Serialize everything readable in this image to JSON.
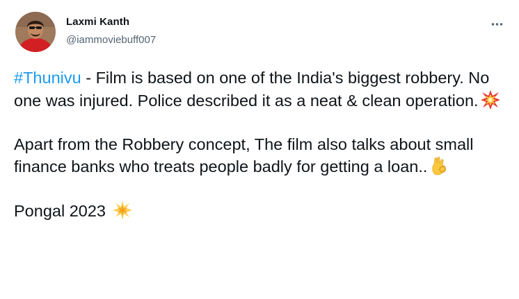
{
  "tweet": {
    "author": {
      "name": "Laxmi Kanth",
      "handle": "@iammoviebuff007"
    },
    "more_icon": "more-horizontal-icon",
    "paragraphs": [
      {
        "hashtag": "#Thunivu",
        "text": " - Film is based on one of the India's biggest robbery. No one was injured. Police described it as a neat & clean operation.",
        "emoji": "collision-emoji"
      },
      {
        "text": "Apart from the Robbery concept, The film also talks about small finance banks who treats people badly for getting a loan..",
        "emoji": "ok-hand-emoji"
      },
      {
        "text": "Pongal 2023 ",
        "emoji": "glowing-star-emoji"
      }
    ],
    "colors": {
      "hashtag": "#1d9bf0",
      "text": "#0f1419",
      "handle": "#536471"
    }
  }
}
